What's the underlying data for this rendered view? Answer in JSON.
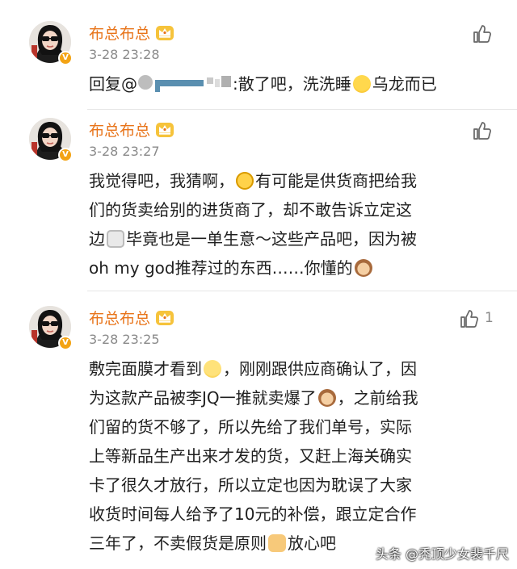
{
  "comments": [
    {
      "username": "布总布总",
      "time": "3-28 23:28",
      "like_count": "",
      "lines": [
        "回复@",
        ":散了吧，洗洗睡",
        "乌龙而已"
      ]
    },
    {
      "username": "布总布总",
      "time": "3-28 23:27",
      "like_count": "",
      "lines": [
        "我觉得吧，我猜啊，",
        "有可能是供货商把给我",
        "们的货卖给别的进货商了，却不敢告诉立定这",
        "边",
        "毕竟也是一单生意～这些产品吧，因为被",
        "oh my god推荐过的东西……你懂的"
      ]
    },
    {
      "username": "布总布总",
      "time": "3-28 23:25",
      "like_count": "1",
      "lines": [
        "敷完面膜才看到",
        "，刚刚跟供应商确认了，因",
        "为这款产品被李JQ一推就卖爆了",
        "，之前给我",
        "们留的货不够了，所以先给了我们单号，实际",
        "上等新品生产出来才发的货，又赶上海关确实",
        "卡了很久才放行，所以立定也因为耽误了大家",
        "收货时间每人给予了10元的补偿，跟立定合作",
        "三年了，不卖假货是原则",
        "放心吧"
      ]
    }
  ],
  "watermark": "头条 @秃顶少女裴千尺",
  "colors": {
    "username": "#e8741a",
    "time": "#8a8a8a",
    "text": "#1f1f1f",
    "badge": "#f3a314"
  },
  "icons": [
    "like-icon",
    "crown-icon",
    "verified-badge-icon",
    "emoji-icon"
  ]
}
